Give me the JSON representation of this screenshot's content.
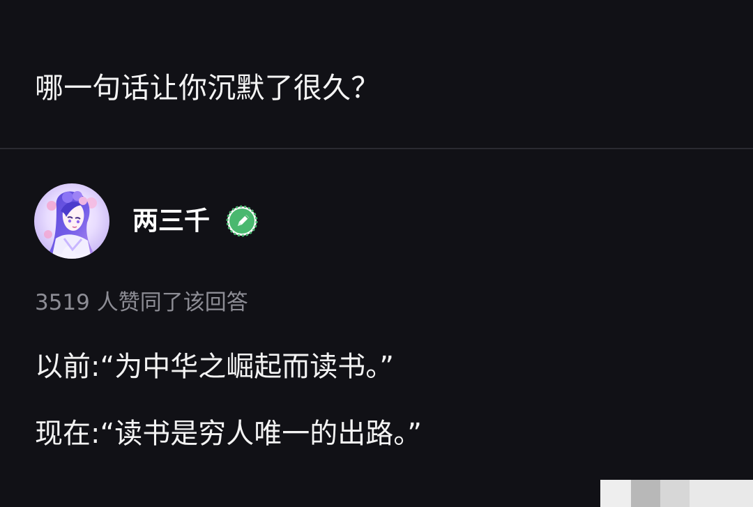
{
  "question": {
    "title": "哪一句话让你沉默了很久？"
  },
  "answer": {
    "author": {
      "name": "两三千",
      "avatar_icon": "anime-girl-avatar-icon",
      "badge_icon": "verified-pen-badge-icon",
      "badge_color": "#49b86f"
    },
    "vote_text": "3519 人赞同了该回答",
    "lines": [
      "以前:“为中华之崛起而读书。”",
      "现在:“读书是穷人唯一的出路。”"
    ]
  },
  "colors": {
    "background": "#111116",
    "primary_text": "#f4f4f4",
    "secondary_text": "#8d8d95",
    "divider": "#2a2a31"
  }
}
